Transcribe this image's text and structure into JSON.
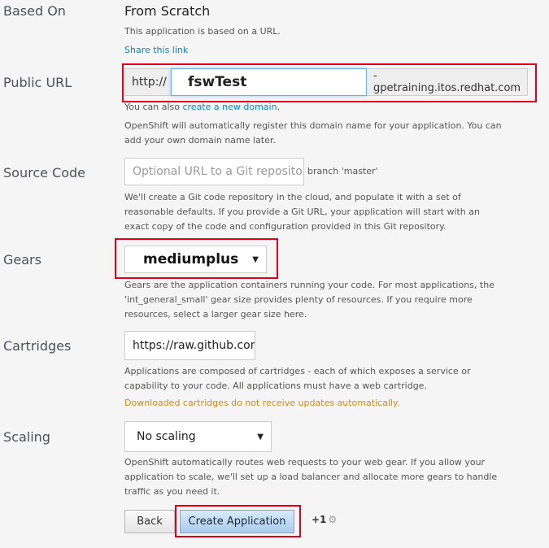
{
  "based_on": {
    "label": "Based On",
    "value": "From Scratch",
    "help": "This application is based on a URL.",
    "share_link": "Share this link"
  },
  "public_url": {
    "label": "Public URL",
    "prefix": "http://",
    "value": "fswTest",
    "suffix": "-gpetraining.itos.redhat.com",
    "help_pre": "You can also ",
    "help_link": "create a new domain",
    "help_post": ".",
    "help2": "OpenShift will automatically register this domain name for your application. You can add your own domain name later."
  },
  "source_code": {
    "label": "Source Code",
    "placeholder": "Optional URL to a Git repositor",
    "branch": "branch 'master'",
    "help": "We'll create a Git code repository in the cloud, and populate it with a set of reasonable defaults. If you provide a Git URL, your application will start with an exact copy of the code and configuration provided in this Git repository."
  },
  "gears": {
    "label": "Gears",
    "selected": "mediumplus",
    "help": "Gears are the application containers running your code. For most applications, the 'int_general_small' gear size provides plenty of resources. If you require more resources, select a larger gear size here."
  },
  "cartridges": {
    "label": "Cartridges",
    "value": "https://raw.github.com",
    "help": "Applications are composed of cartridges - each of which exposes a service or capability to your code. All applications must have a web cartridge.",
    "warning": "Downloaded cartridges do not receive updates automatically."
  },
  "scaling": {
    "label": "Scaling",
    "selected": "No scaling",
    "help": "OpenShift automatically routes web requests to your web gear. If you allow your application to scale, we'll set up a load balancer and allocate more gears to handle traffic as you need it."
  },
  "actions": {
    "back": "Back",
    "create": "Create Application",
    "plus_one": "+1"
  },
  "colors": {
    "highlight": "#e0001b",
    "link": "#0085cf",
    "warning": "#d18a16"
  }
}
